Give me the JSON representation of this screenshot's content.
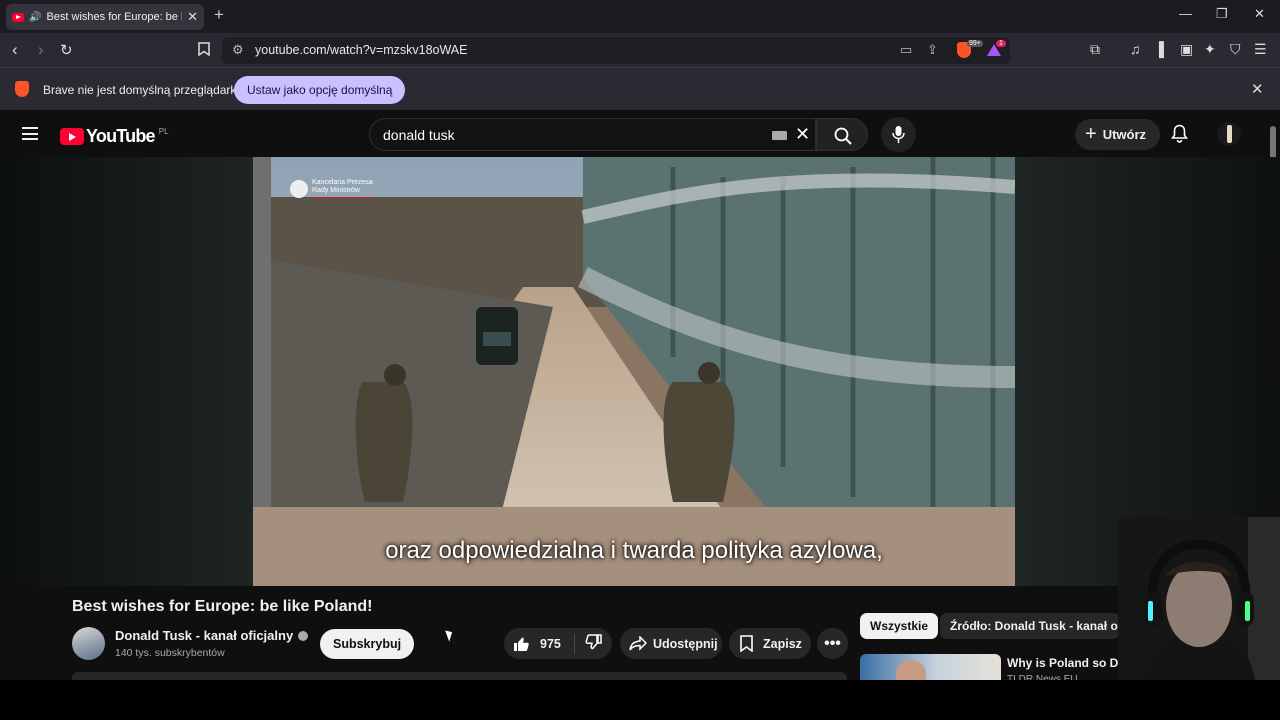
{
  "browser": {
    "tab_title": "Best wishes for Europe: be like Poland!",
    "tab_close": "✕",
    "new_tab": "+",
    "url": "youtube.com/watch?v=mzskv18oWAE",
    "window_minimize": "—",
    "window_restore": "❐",
    "window_close": "✕",
    "brave_badge": "99+",
    "rewards_badge": "1"
  },
  "infobar": {
    "message": "Brave nie jest domyślną przeglądarką",
    "button_label": "Ustaw jako opcję domyślną"
  },
  "youtube": {
    "logo_text": "YouTube",
    "country_code": "PL",
    "search_query": "donald tusk",
    "create_label": "Utwórz"
  },
  "video": {
    "subtitle": "oraz odpowiedzialna i twarda polityka azylowa,",
    "watermark_line1": "Kancelaria Prezesa",
    "watermark_line2": "Rady Ministrów",
    "title": "Best wishes for Europe: be like Poland!",
    "channel_name": "Donald Tusk - kanał oficjalny",
    "subscribers": "140 tys. subskrybentów",
    "subscribe_label": "Subskrybuj",
    "likes": "975",
    "share_label": "Udostępnij",
    "save_label": "Zapisz"
  },
  "sidebar": {
    "chips": [
      "Wszystkie",
      "Źródło: Donald Tusk - kanał oficjalny"
    ],
    "recommendation_title": "Why is Poland so Divi",
    "recommendation_channel": "TLDR News EU"
  },
  "colors": {
    "brand_red": "#ff0033",
    "brave_orange": "#fb542b",
    "infobar_button": "#c8c0ff"
  }
}
